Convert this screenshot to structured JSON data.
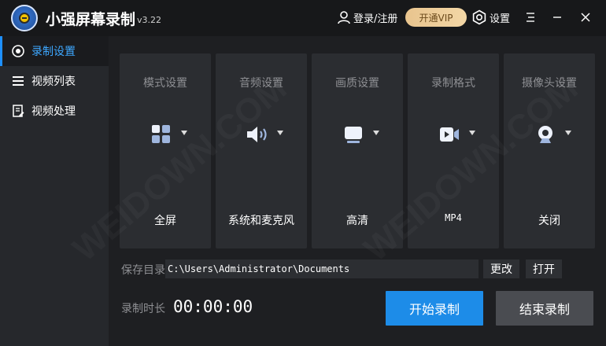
{
  "titlebar": {
    "app_title": "小强屏幕录制",
    "version": "v3.22",
    "login_label": "登录/注册",
    "vip_label": "开通VIP",
    "settings_label": "设置"
  },
  "sidebar": {
    "items": [
      {
        "label": "录制设置",
        "icon": "record-icon",
        "active": true
      },
      {
        "label": "视频列表",
        "icon": "list-icon",
        "active": false
      },
      {
        "label": "视频处理",
        "icon": "edit-document-icon",
        "active": false
      }
    ]
  },
  "cards": [
    {
      "title": "模式设置",
      "icon": "grid-mode-icon",
      "value": "全屏"
    },
    {
      "title": "音频设置",
      "icon": "speaker-icon",
      "value": "系统和麦克风"
    },
    {
      "title": "画质设置",
      "icon": "monitor-icon",
      "value": "高清"
    },
    {
      "title": "录制格式",
      "icon": "video-camera-icon",
      "value": "MP4"
    },
    {
      "title": "摄像头设置",
      "icon": "webcam-icon",
      "value": "关闭"
    }
  ],
  "save": {
    "label": "保存目录",
    "path": "C:\\Users\\Administrator\\Documents",
    "change_label": "更改",
    "open_label": "打开"
  },
  "timer": {
    "label": "录制时长",
    "value": "00:00:00"
  },
  "actions": {
    "start_label": "开始录制",
    "stop_label": "结束录制"
  },
  "colors": {
    "accent": "#1d8ce8",
    "active_text": "#3da7ff",
    "vip_gold": "#f3d7a6",
    "background": "#1e1f22",
    "card": "#2b2d31"
  },
  "watermark": "WEIDOWN.COM"
}
